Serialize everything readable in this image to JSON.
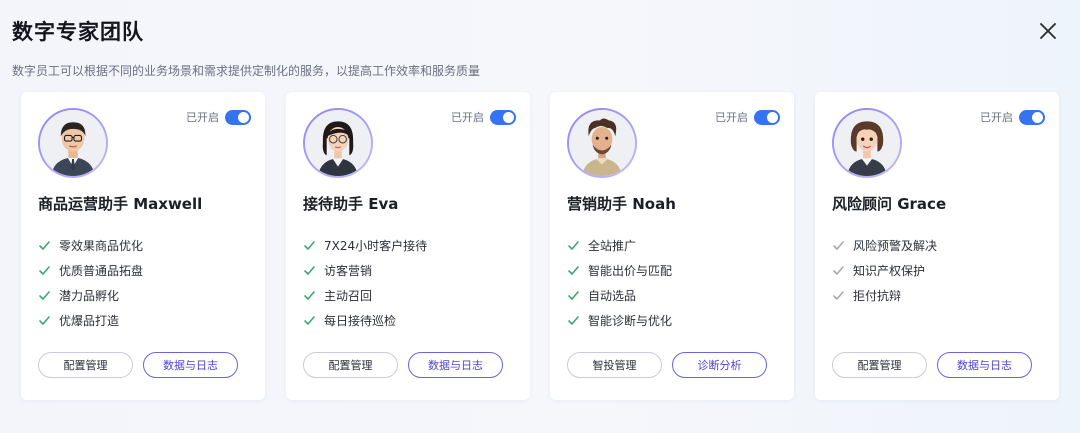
{
  "dialog": {
    "title": "数字专家团队",
    "subtitle": "数字员工可以根据不同的业务场景和需求提供定制化的服务，以提高工作效率和服务质量",
    "close_icon": "close-icon"
  },
  "colors": {
    "toggle_on": "#3574f0",
    "check_green": "#3aa876",
    "check_grey": "#a6a9b2",
    "accent_button": "#4e46c7"
  },
  "cards": [
    {
      "title": "商品运营助手 Maxwell",
      "status": "已开启",
      "enabled": true,
      "features": [
        "零效果商品优化",
        "优质普通品拓盘",
        "潜力品孵化",
        "优爆品打造"
      ],
      "button_left": "配置管理",
      "button_right": "数据与日志"
    },
    {
      "title": "接待助手 Eva",
      "status": "已开启",
      "enabled": true,
      "features": [
        "7X24小时客户接待",
        "访客营销",
        "主动召回",
        "每日接待巡检"
      ],
      "button_left": "配置管理",
      "button_right": "数据与日志"
    },
    {
      "title": "营销助手 Noah",
      "status": "已开启",
      "enabled": true,
      "features": [
        "全站推广",
        "智能出价与匹配",
        "自动选品",
        "智能诊断与优化"
      ],
      "button_left": "智投管理",
      "button_right": "诊断分析"
    },
    {
      "title": "风险顾问 Grace",
      "status": "已开启",
      "enabled": true,
      "features": [
        "风险预警及解决",
        "知识产权保护",
        "拒付抗辩"
      ],
      "button_left": "配置管理",
      "button_right": "数据与日志"
    }
  ]
}
